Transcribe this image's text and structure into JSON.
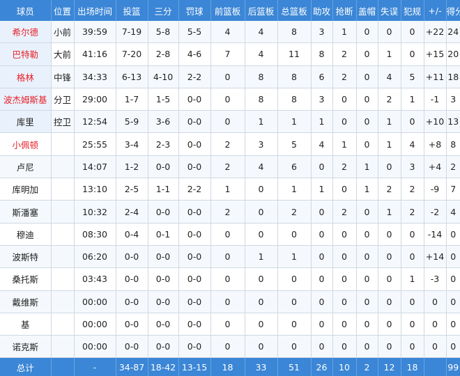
{
  "headers": [
    "球员",
    "位置",
    "出场时间",
    "投篮",
    "三分",
    "罚球",
    "前篮板",
    "后篮板",
    "总篮板",
    "助攻",
    "抢断",
    "盖帽",
    "失误",
    "犯规",
    "+/-",
    "得分"
  ],
  "players": [
    {
      "name": "希尔德",
      "highlight": true,
      "starter": true,
      "stats": [
        "小前",
        "39:59",
        "7-19",
        "5-8",
        "5-5",
        "4",
        "4",
        "8",
        "3",
        "1",
        "0",
        "0",
        "0",
        "+22",
        "24"
      ]
    },
    {
      "name": "巴特勒",
      "highlight": true,
      "starter": true,
      "stats": [
        "大前",
        "41:16",
        "7-20",
        "2-8",
        "4-6",
        "7",
        "4",
        "11",
        "8",
        "2",
        "0",
        "1",
        "0",
        "+15",
        "20"
      ]
    },
    {
      "name": "格林",
      "highlight": true,
      "starter": true,
      "stats": [
        "中锋",
        "34:33",
        "6-13",
        "4-10",
        "2-2",
        "0",
        "8",
        "8",
        "6",
        "2",
        "0",
        "4",
        "5",
        "+11",
        "18"
      ]
    },
    {
      "name": "波杰姆斯基",
      "highlight": true,
      "starter": true,
      "stats": [
        "分卫",
        "29:00",
        "1-7",
        "1-5",
        "0-0",
        "0",
        "8",
        "8",
        "3",
        "0",
        "0",
        "2",
        "1",
        "-1",
        "3"
      ]
    },
    {
      "name": "库里",
      "highlight": false,
      "starter": true,
      "stats": [
        "控卫",
        "12:54",
        "5-9",
        "3-6",
        "0-0",
        "0",
        "1",
        "1",
        "1",
        "0",
        "0",
        "1",
        "0",
        "+10",
        "13"
      ]
    },
    {
      "name": "小佩顿",
      "highlight": true,
      "starter": false,
      "stats": [
        "",
        "25:55",
        "3-4",
        "2-3",
        "0-0",
        "2",
        "3",
        "5",
        "4",
        "1",
        "0",
        "1",
        "4",
        "+8",
        "8"
      ]
    },
    {
      "name": "卢尼",
      "highlight": false,
      "starter": false,
      "stats": [
        "",
        "14:07",
        "1-2",
        "0-0",
        "0-0",
        "2",
        "4",
        "6",
        "0",
        "2",
        "1",
        "0",
        "3",
        "+4",
        "2"
      ]
    },
    {
      "name": "库明加",
      "highlight": false,
      "starter": false,
      "stats": [
        "",
        "13:10",
        "2-5",
        "1-1",
        "2-2",
        "1",
        "0",
        "1",
        "1",
        "0",
        "1",
        "2",
        "2",
        "-9",
        "7"
      ]
    },
    {
      "name": "斯潘塞",
      "highlight": false,
      "starter": false,
      "stats": [
        "",
        "10:32",
        "2-4",
        "0-0",
        "0-0",
        "2",
        "0",
        "2",
        "0",
        "2",
        "0",
        "1",
        "2",
        "-2",
        "4"
      ]
    },
    {
      "name": "穆迪",
      "highlight": false,
      "starter": false,
      "stats": [
        "",
        "08:30",
        "0-4",
        "0-1",
        "0-0",
        "0",
        "0",
        "0",
        "0",
        "0",
        "0",
        "0",
        "0",
        "-14",
        "0"
      ]
    },
    {
      "name": "波斯特",
      "highlight": false,
      "starter": false,
      "stats": [
        "",
        "06:20",
        "0-0",
        "0-0",
        "0-0",
        "0",
        "1",
        "1",
        "0",
        "0",
        "0",
        "0",
        "0",
        "+14",
        "0"
      ]
    },
    {
      "name": "桑托斯",
      "highlight": false,
      "starter": false,
      "stats": [
        "",
        "03:43",
        "0-0",
        "0-0",
        "0-0",
        "0",
        "0",
        "0",
        "0",
        "0",
        "0",
        "0",
        "1",
        "-3",
        "0"
      ]
    },
    {
      "name": "戴维斯",
      "highlight": false,
      "starter": false,
      "stats": [
        "",
        "00:00",
        "0-0",
        "0-0",
        "0-0",
        "0",
        "0",
        "0",
        "0",
        "0",
        "0",
        "0",
        "0",
        "0",
        "0"
      ]
    },
    {
      "name": "基",
      "highlight": false,
      "starter": false,
      "stats": [
        "",
        "00:00",
        "0-0",
        "0-0",
        "0-0",
        "0",
        "0",
        "0",
        "0",
        "0",
        "0",
        "0",
        "0",
        "0",
        "0"
      ]
    },
    {
      "name": "诺克斯",
      "highlight": false,
      "starter": false,
      "stats": [
        "",
        "00:00",
        "0-0",
        "0-0",
        "0-0",
        "0",
        "0",
        "0",
        "0",
        "0",
        "0",
        "0",
        "0",
        "0",
        "0"
      ]
    }
  ],
  "totals": [
    "总计",
    "",
    "-",
    "34-87",
    "18-42",
    "13-15",
    "18",
    "33",
    "51",
    "26",
    "10",
    "2",
    "12",
    "18",
    "",
    "99"
  ],
  "colors": {
    "header_bg": "#3b86d6",
    "highlight_name": "#e8212b",
    "starter_bg": "#e9f2fc"
  }
}
